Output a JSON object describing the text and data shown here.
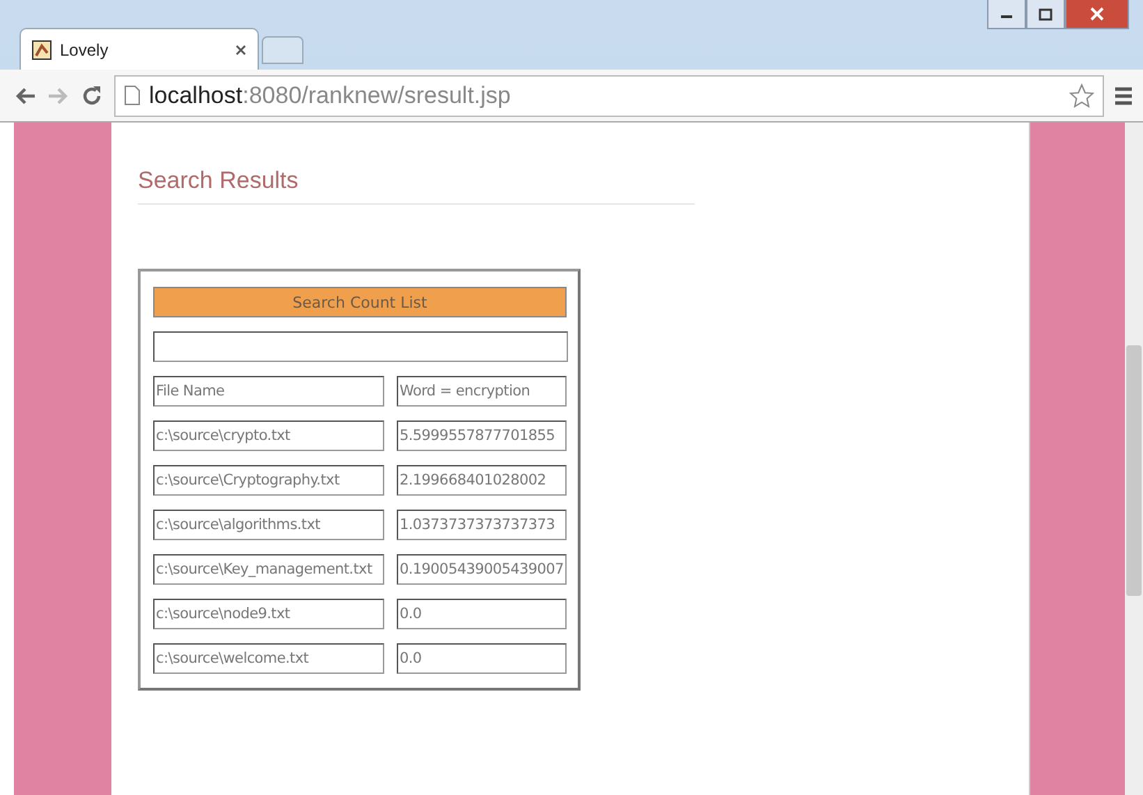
{
  "browser": {
    "tab_title": "Lovely",
    "url_host": "localhost",
    "url_path": ":8080/ranknew/sresult.jsp"
  },
  "page": {
    "heading": "Search Results",
    "table": {
      "title": "Search Count List",
      "header": [
        "File Name",
        "Word = encryption"
      ],
      "rows": [
        [
          "c:\\source\\crypto.txt",
          "5.5999557877701855"
        ],
        [
          "c:\\source\\Cryptography.txt",
          "2.199668401028002"
        ],
        [
          "c:\\source\\algorithms.txt",
          "1.0373737373737373"
        ],
        [
          "c:\\source\\Key_management.txt",
          "0.19005439005439007"
        ],
        [
          "c:\\source\\node9.txt",
          "0.0"
        ],
        [
          "c:\\source\\welcome.txt",
          "0.0"
        ]
      ]
    }
  }
}
